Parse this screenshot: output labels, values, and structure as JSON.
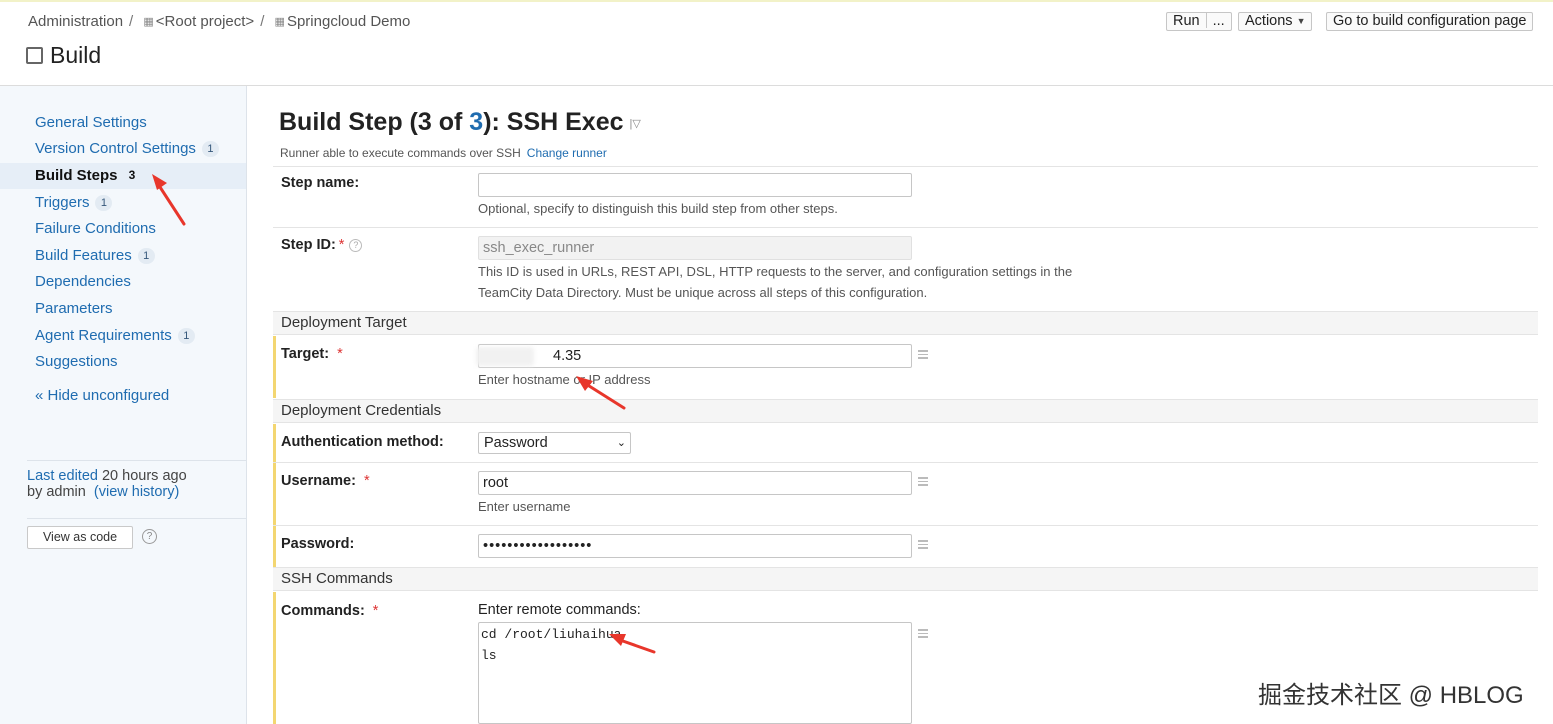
{
  "breadcrumb": {
    "items": [
      "Administration",
      "<Root project>",
      "Springcloud Demo"
    ],
    "project_icon": "project-icon"
  },
  "page": {
    "title": "Build"
  },
  "header_actions": {
    "run": "Run",
    "run_more": "...",
    "actions": "Actions",
    "go_to": "Go to build configuration page"
  },
  "sidebar": {
    "items": [
      {
        "label": "General Settings",
        "count": ""
      },
      {
        "label": "Version Control Settings",
        "count": "1"
      },
      {
        "label": "Build Steps",
        "count": "3"
      },
      {
        "label": "Triggers",
        "count": "1"
      },
      {
        "label": "Failure Conditions",
        "count": ""
      },
      {
        "label": "Build Features",
        "count": "1"
      },
      {
        "label": "Dependencies",
        "count": ""
      },
      {
        "label": "Parameters",
        "count": ""
      },
      {
        "label": "Agent Requirements",
        "count": "1"
      },
      {
        "label": "Suggestions",
        "count": ""
      }
    ],
    "hide_unconfigured": "« Hide unconfigured",
    "last_edited_label": "Last edited",
    "last_edited_time": "20 hours ago",
    "by_admin": "by admin",
    "view_history": "(view history)",
    "view_as_code": "View as code"
  },
  "step": {
    "title_prefix": "Build Step (3 of ",
    "title_num": "3",
    "title_suffix": "): SSH Exec",
    "runner_desc": "Runner able to execute commands over SSH",
    "change_runner": "Change runner"
  },
  "form": {
    "step_name_label": "Step name:",
    "step_name_value": "",
    "step_name_note": "Optional, specify to distinguish this build step from other steps.",
    "step_id_label": "Step ID:",
    "step_id_value": "ssh_exec_runner",
    "step_id_note_1": "This ID is used in URLs, REST API, DSL, HTTP requests to the server, and configuration settings in the",
    "step_id_note_2": "TeamCity Data Directory. Must be unique across all steps of this configuration.",
    "section_target": "Deployment Target",
    "target_label": "Target:",
    "target_value": "4.35",
    "target_note": "Enter hostname or IP address",
    "section_credentials": "Deployment Credentials",
    "auth_label": "Authentication method:",
    "auth_value": "Password",
    "username_label": "Username:",
    "username_value": "root",
    "username_note": "Enter username",
    "password_label": "Password:",
    "password_value": "••••••••••••••••••",
    "section_commands": "SSH Commands",
    "commands_label": "Commands:",
    "commands_hint": "Enter remote commands:",
    "commands_value": "cd /root/liuhaihua\nls"
  },
  "watermark": "掘金技术社区 @ HBLOG",
  "colors": {
    "link": "#1f6cb0",
    "required": "#d33333",
    "required_bar": "#f3d671",
    "annotation_arrow": "#e8362b"
  }
}
